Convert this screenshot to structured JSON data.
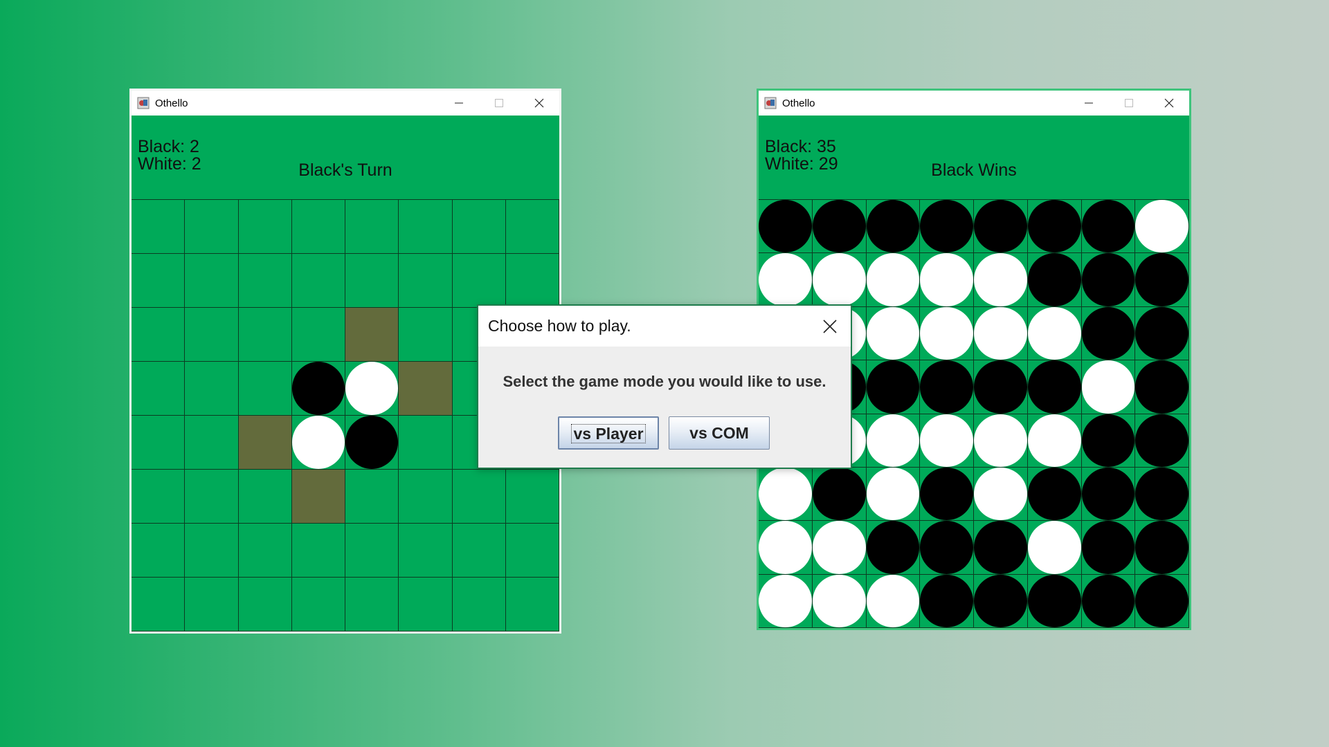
{
  "left_window": {
    "title": "Othello",
    "score_black": "Black: 2",
    "score_white": "White: 2",
    "status": "Black's Turn",
    "board": [
      "........",
      "........",
      "....h...",
      "...BWh..",
      "..hWB...",
      "...h....",
      "........",
      "........"
    ]
  },
  "right_window": {
    "title": "Othello",
    "score_black": "Black: 35",
    "score_white": "White: 29",
    "status": "Black Wins",
    "board": [
      "BBBBBBBW",
      "WWWWWBBB",
      "WWWWWWBB",
      "WBBBBBWB",
      "BWWWWWBB",
      "WBWBWBBB",
      "WWBBBWBB",
      "WWWBBBBB"
    ]
  },
  "dialog": {
    "title": "Choose how to play.",
    "message": "Select the game mode you would like to use.",
    "btn_player": "vs Player",
    "btn_com": "vs COM"
  },
  "colors": {
    "board_green": "#00aa59",
    "hint_cell": "#636b3c",
    "grid_line": "#0c3c22"
  },
  "legend": {
    "B": "black piece",
    "W": "white piece",
    "h": "valid move hint",
    ".": "empty"
  },
  "icons": [
    "othello-app-icon",
    "minimize-icon",
    "maximize-icon",
    "close-icon"
  ]
}
